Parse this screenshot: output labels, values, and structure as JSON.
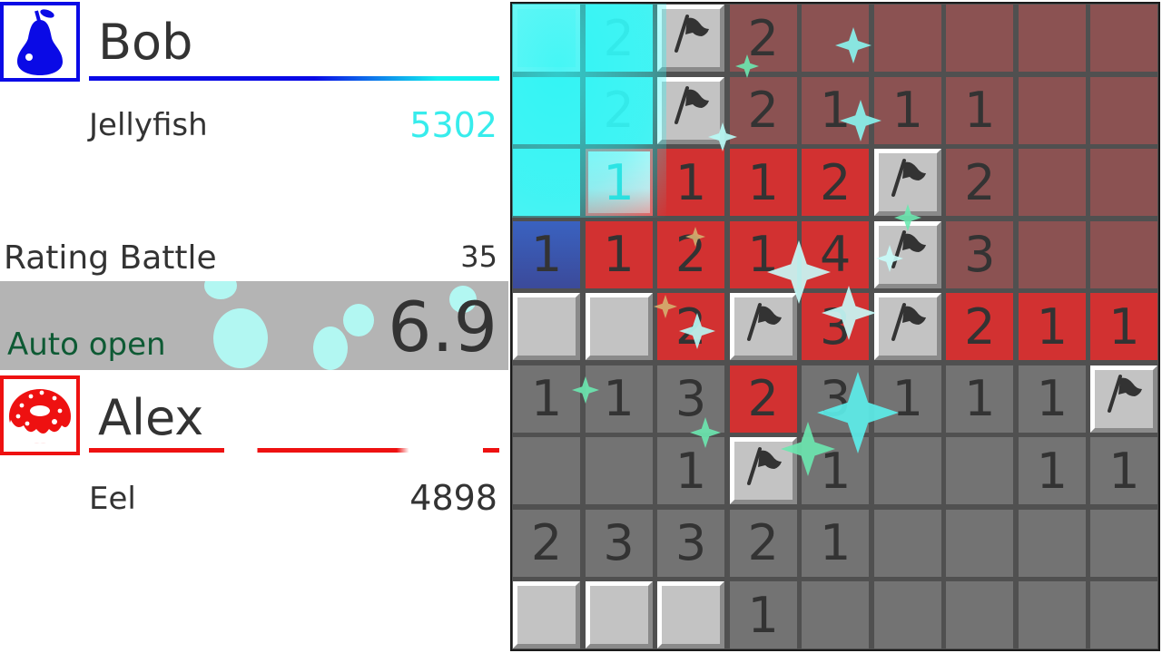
{
  "players": [
    {
      "name": "Bob",
      "title": "Jellyfish",
      "score": "5302",
      "avatar_icon": "pear-icon",
      "color": "#0a0ae6"
    },
    {
      "name": "Alex",
      "title": "Eel",
      "score": "4898",
      "avatar_icon": "donut-icon",
      "color": "#ee1111"
    }
  ],
  "match": {
    "mode": "Rating Battle",
    "mode_value": "35",
    "status_label": "Auto open",
    "timer": "6.9"
  },
  "board": {
    "cols": 9,
    "rows": 9,
    "cells": [
      [
        {
          "s": "covered",
          "t": "cyan"
        },
        {
          "s": "num",
          "v": "2",
          "t": "cyan"
        },
        {
          "s": "flag"
        },
        {
          "s": "num",
          "v": "2",
          "t": "darkred"
        },
        {
          "s": "empty",
          "t": "darkred"
        },
        {
          "s": "empty",
          "t": "darkred"
        },
        {
          "s": "empty",
          "t": "darkred"
        },
        {
          "s": "empty",
          "t": "darkred"
        },
        {
          "s": "empty",
          "t": "darkred"
        }
      ],
      [
        {
          "s": "empty",
          "t": "cyan"
        },
        {
          "s": "num",
          "v": "2",
          "t": "cyan"
        },
        {
          "s": "flag"
        },
        {
          "s": "num",
          "v": "2",
          "t": "darkred"
        },
        {
          "s": "num",
          "v": "1",
          "t": "darkred"
        },
        {
          "s": "num",
          "v": "1",
          "t": "darkred"
        },
        {
          "s": "num",
          "v": "1",
          "t": "darkred"
        },
        {
          "s": "empty",
          "t": "darkred"
        },
        {
          "s": "empty",
          "t": "darkred"
        }
      ],
      [
        {
          "s": "empty",
          "t": "cyan"
        },
        {
          "s": "num",
          "v": "1",
          "t": "highlight"
        },
        {
          "s": "num",
          "v": "1",
          "t": "red"
        },
        {
          "s": "num",
          "v": "1",
          "t": "red"
        },
        {
          "s": "num",
          "v": "2",
          "t": "red"
        },
        {
          "s": "flag"
        },
        {
          "s": "num",
          "v": "2",
          "t": "darkred"
        },
        {
          "s": "empty",
          "t": "darkred"
        },
        {
          "s": "empty",
          "t": "darkred"
        }
      ],
      [
        {
          "s": "num",
          "v": "1",
          "t": "blue"
        },
        {
          "s": "num",
          "v": "1",
          "t": "red"
        },
        {
          "s": "num",
          "v": "2",
          "t": "red"
        },
        {
          "s": "num",
          "v": "1",
          "t": "red"
        },
        {
          "s": "num",
          "v": "4",
          "t": "red"
        },
        {
          "s": "flag"
        },
        {
          "s": "num",
          "v": "3",
          "t": "darkred"
        },
        {
          "s": "empty",
          "t": "darkred"
        },
        {
          "s": "empty",
          "t": "darkred"
        }
      ],
      [
        {
          "s": "covered"
        },
        {
          "s": "covered"
        },
        {
          "s": "num",
          "v": "2",
          "t": "red"
        },
        {
          "s": "flag"
        },
        {
          "s": "num",
          "v": "3",
          "t": "red"
        },
        {
          "s": "flag"
        },
        {
          "s": "num",
          "v": "2",
          "t": "red"
        },
        {
          "s": "num",
          "v": "1",
          "t": "red"
        },
        {
          "s": "num",
          "v": "1",
          "t": "red"
        }
      ],
      [
        {
          "s": "num",
          "v": "1"
        },
        {
          "s": "num",
          "v": "1"
        },
        {
          "s": "num",
          "v": "3"
        },
        {
          "s": "num",
          "v": "2",
          "t": "red"
        },
        {
          "s": "num",
          "v": "3"
        },
        {
          "s": "num",
          "v": "1"
        },
        {
          "s": "num",
          "v": "1"
        },
        {
          "s": "num",
          "v": "1"
        },
        {
          "s": "flag"
        }
      ],
      [
        {
          "s": "empty"
        },
        {
          "s": "empty"
        },
        {
          "s": "num",
          "v": "1"
        },
        {
          "s": "flag"
        },
        {
          "s": "num",
          "v": "1"
        },
        {
          "s": "empty"
        },
        {
          "s": "empty"
        },
        {
          "s": "num",
          "v": "1"
        },
        {
          "s": "num",
          "v": "1"
        }
      ],
      [
        {
          "s": "num",
          "v": "2"
        },
        {
          "s": "num",
          "v": "3"
        },
        {
          "s": "num",
          "v": "3"
        },
        {
          "s": "num",
          "v": "2"
        },
        {
          "s": "num",
          "v": "1"
        },
        {
          "s": "empty"
        },
        {
          "s": "empty"
        },
        {
          "s": "empty"
        },
        {
          "s": "empty"
        }
      ],
      [
        {
          "s": "covered"
        },
        {
          "s": "covered"
        },
        {
          "s": "covered"
        },
        {
          "s": "num",
          "v": "1"
        },
        {
          "s": "empty"
        },
        {
          "s": "empty"
        },
        {
          "s": "empty"
        },
        {
          "s": "empty"
        },
        {
          "s": "empty"
        }
      ]
    ]
  }
}
